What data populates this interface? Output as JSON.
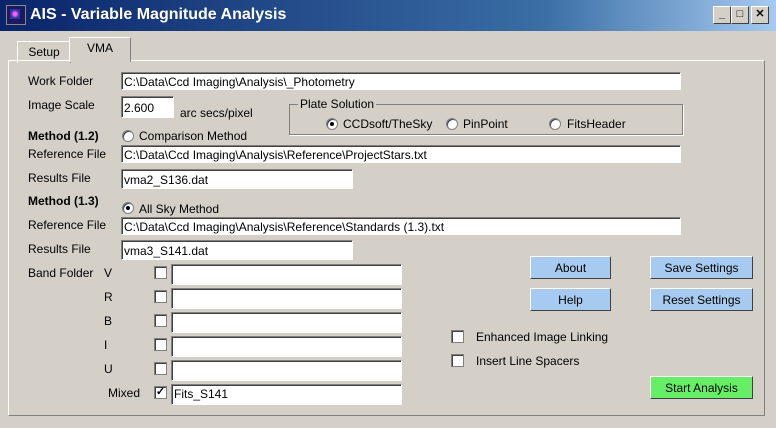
{
  "window": {
    "title": "AIS - Variable Magnitude Analysis",
    "min": "_",
    "max": "□",
    "close": "✕"
  },
  "tabs": [
    {
      "label": "Setup"
    },
    {
      "label": "VMA"
    }
  ],
  "work_folder": {
    "label": "Work Folder",
    "value": "C:\\Data\\Ccd Imaging\\Analysis\\_Photometry"
  },
  "image_scale": {
    "label": "Image Scale",
    "value": "2.600",
    "unit": "arc secs/pixel"
  },
  "plate_solution": {
    "label": "Plate Solution",
    "options": [
      "CCDsoft/TheSky",
      "PinPoint",
      "FitsHeader"
    ],
    "selected": "CCDsoft/TheSky"
  },
  "method12": {
    "label": "Method (1.2)",
    "radio_label": "Comparison Method",
    "reference_label": "Reference File",
    "reference_value": "C:\\Data\\Ccd Imaging\\Analysis\\Reference\\ProjectStars.txt",
    "results_label": "Results File",
    "results_value": "vma2_S136.dat"
  },
  "method13": {
    "label": "Method (1.3)",
    "radio_label": "All Sky Method",
    "reference_label": "Reference File",
    "reference_value": "C:\\Data\\Ccd Imaging\\Analysis\\Reference\\Standards (1.3).txt",
    "results_label": "Results File",
    "results_value": "vma3_S141.dat"
  },
  "band_folder": {
    "label": "Band Folder",
    "bands": [
      {
        "name": "V",
        "checked": false,
        "value": ""
      },
      {
        "name": "R",
        "checked": false,
        "value": ""
      },
      {
        "name": "B",
        "checked": false,
        "value": ""
      },
      {
        "name": "I",
        "checked": false,
        "value": ""
      },
      {
        "name": "U",
        "checked": false,
        "value": ""
      }
    ],
    "mixed": {
      "name": "Mixed",
      "checked": true,
      "value": "Fits_S141",
      "mark": "✓"
    }
  },
  "options": {
    "enhanced_linking": "Enhanced Image Linking",
    "insert_spacers": "Insert Line Spacers"
  },
  "buttons": {
    "about": "About",
    "help": "Help",
    "save": "Save Settings",
    "reset": "Reset Settings",
    "start": "Start Analysis"
  },
  "colors": {
    "title_start": "#0a246a",
    "button_blue": "#a6caf0",
    "button_green": "#66ee66",
    "face": "#d4d0c8"
  }
}
